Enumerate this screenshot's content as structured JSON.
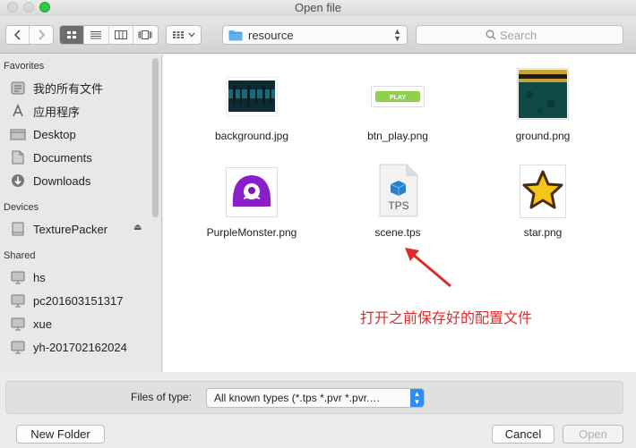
{
  "window": {
    "title": "Open file"
  },
  "toolbar": {
    "path_label": "resource",
    "search_placeholder": "Search"
  },
  "sidebar": {
    "favorites_heading": "Favorites",
    "favorites": [
      {
        "label": "我的所有文件",
        "icon": "all-files-icon"
      },
      {
        "label": "应用程序",
        "icon": "applications-icon"
      },
      {
        "label": "Desktop",
        "icon": "desktop-icon"
      },
      {
        "label": "Documents",
        "icon": "documents-icon"
      },
      {
        "label": "Downloads",
        "icon": "downloads-icon"
      }
    ],
    "devices_heading": "Devices",
    "devices": [
      {
        "label": "TexturePacker",
        "icon": "drive-icon"
      }
    ],
    "shared_heading": "Shared",
    "shared": [
      {
        "label": "hs",
        "icon": "computer-icon"
      },
      {
        "label": "pc201603151317",
        "icon": "computer-icon"
      },
      {
        "label": "xue",
        "icon": "computer-icon"
      },
      {
        "label": "yh-201702162024",
        "icon": "computer-icon"
      }
    ]
  },
  "files": [
    {
      "name": "background.jpg",
      "thumb": "background-thumb"
    },
    {
      "name": "btn_play.png",
      "thumb": "play-button-thumb",
      "thumb_text": "PLAY"
    },
    {
      "name": "ground.png",
      "thumb": "ground-thumb"
    },
    {
      "name": "PurpleMonster.png",
      "thumb": "purple-monster-thumb"
    },
    {
      "name": "scene.tps",
      "thumb": "tps-document-icon",
      "thumb_text": "TPS"
    },
    {
      "name": "star.png",
      "thumb": "star-thumb"
    }
  ],
  "annotation": "打开之前保存好的配置文件",
  "footer": {
    "filter_label": "Files of type:",
    "filter_value": "All known types (*.tps *.pvr *.pvr.…",
    "new_folder": "New Folder",
    "cancel": "Cancel",
    "open": "Open"
  },
  "colors": {
    "accent": "#2f8cf0",
    "annotation": "#e02a2a",
    "monster": "#8a1ec9",
    "star": "#f5c518"
  }
}
